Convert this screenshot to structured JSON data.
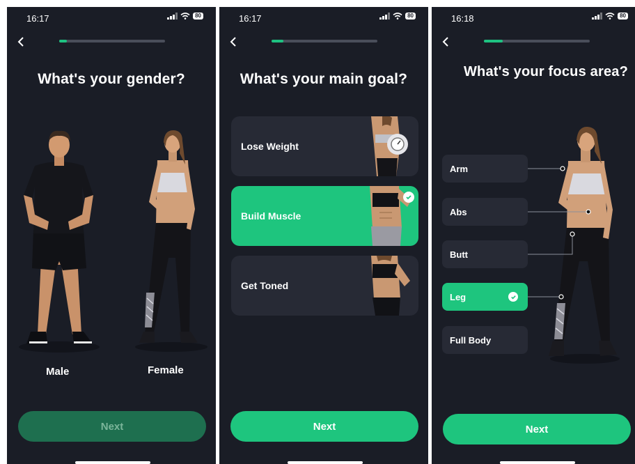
{
  "screens": [
    {
      "time": "16:17",
      "battery": "80",
      "progress": 0.07,
      "title": "What's your gender?",
      "options": [
        {
          "label": "Male"
        },
        {
          "label": "Female"
        }
      ],
      "next_label": "Next",
      "next_enabled": false
    },
    {
      "time": "16:17",
      "battery": "80",
      "progress": 0.11,
      "title": "What's your main goal?",
      "goals": [
        {
          "label": "Lose Weight",
          "selected": false
        },
        {
          "label": "Build Muscle",
          "selected": true
        },
        {
          "label": "Get Toned",
          "selected": false
        }
      ],
      "next_label": "Next",
      "next_enabled": true
    },
    {
      "time": "16:18",
      "battery": "80",
      "progress": 0.18,
      "title": "What's your focus area?",
      "areas": [
        {
          "label": "Arm",
          "selected": false
        },
        {
          "label": "Abs",
          "selected": false
        },
        {
          "label": "Butt",
          "selected": false
        },
        {
          "label": "Leg",
          "selected": true
        },
        {
          "label": "Full Body",
          "selected": false
        }
      ],
      "next_label": "Next",
      "next_enabled": true
    }
  ],
  "colors": {
    "background": "#1a1d26",
    "card": "#272a35",
    "accent": "#1ec57e",
    "accent_disabled": "#1e6f4f",
    "track": "#4a4e5a"
  }
}
